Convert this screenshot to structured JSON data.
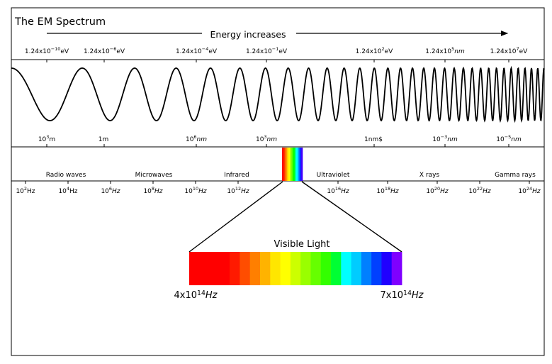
{
  "title": "The EM Spectrum",
  "energy_arrow_label": "Energy increases",
  "energy_labels": [
    {
      "base": "1.24x10",
      "exp": "−10",
      "unit": "eV",
      "unit_italic": false
    },
    {
      "base": "1.24x10",
      "exp": "−6",
      "unit": "eV",
      "unit_italic": false
    },
    {
      "base": "1.24x10",
      "exp": "−4",
      "unit": "eV",
      "unit_italic": false
    },
    {
      "base": "1.24x10",
      "exp": "−1",
      "unit": "eV",
      "unit_italic": false
    },
    {
      "base": "1.24x10",
      "exp": "2",
      "unit": "eV",
      "unit_italic": false
    },
    {
      "base": "1.24x10",
      "exp": "5",
      "unit": "nm",
      "unit_italic": true
    },
    {
      "base": "1.24x10",
      "exp": "7",
      "unit": "eV",
      "unit_italic": false
    }
  ],
  "wavelength_labels": [
    {
      "base": "10",
      "exp": "3",
      "unit": "m",
      "unit_italic": false
    },
    {
      "base": "1m",
      "exp": "",
      "unit": "",
      "unit_italic": false
    },
    {
      "base": "10",
      "exp": "6",
      "unit": "nm",
      "unit_italic": true
    },
    {
      "base": "10",
      "exp": "3",
      "unit": "nm",
      "unit_italic": true
    },
    {
      "base": "1nm$",
      "exp": "",
      "unit": "",
      "unit_italic": false
    },
    {
      "base": "10",
      "exp": "−3",
      "unit": "nm",
      "unit_italic": true
    },
    {
      "base": "10",
      "exp": "−5",
      "unit": "nm",
      "unit_italic": true
    }
  ],
  "bands": [
    "Radio waves",
    "Microwaves",
    "Infrared",
    "Ultraviolet",
    "X rays",
    "Gamma rays"
  ],
  "frequency_labels": [
    {
      "base": "10",
      "exp": "2",
      "unit": "Hz",
      "unit_italic": false
    },
    {
      "base": "10",
      "exp": "4",
      "unit": "Hz",
      "unit_italic": false
    },
    {
      "base": "10",
      "exp": "6",
      "unit": "Hz",
      "unit_italic": true
    },
    {
      "base": "10",
      "exp": "8",
      "unit": "Hz",
      "unit_italic": true
    },
    {
      "base": "10",
      "exp": "10",
      "unit": "Hz",
      "unit_italic": true
    },
    {
      "base": "10",
      "exp": "12",
      "unit": "Hz",
      "unit_italic": true
    },
    {
      "base": "10",
      "exp": "16",
      "unit": "Hz",
      "unit_italic": true
    },
    {
      "base": "10",
      "exp": "18",
      "unit": "Hz",
      "unit_italic": true
    },
    {
      "base": "10",
      "exp": "20",
      "unit": "Hz",
      "unit_italic": true
    },
    {
      "base": "10",
      "exp": "22",
      "unit": "Hz",
      "unit_italic": true
    },
    {
      "base": "10",
      "exp": "24",
      "unit": "Hz",
      "unit_italic": true
    }
  ],
  "visible": {
    "title": "Visible Light",
    "low_freq": {
      "base": "4x10",
      "exp": "14",
      "unit": "Hz"
    },
    "high_freq": {
      "base": "7x10",
      "exp": "14",
      "unit": "Hz"
    },
    "colors": [
      "#ff0000",
      "#ff0000",
      "#ff0000",
      "#ff0000",
      "#ff1a00",
      "#ff4d00",
      "#ff7f00",
      "#ffb300",
      "#ffe600",
      "#ffff00",
      "#ccff00",
      "#99ff00",
      "#66ff00",
      "#33ff00",
      "#00ff33",
      "#00ffff",
      "#00ccff",
      "#0080ff",
      "#0040ff",
      "#2000ff",
      "#7f00ff"
    ],
    "mini_colors": [
      "#ff0000",
      "#ff3300",
      "#ff8000",
      "#ffcc00",
      "#ffff00",
      "#aaff00",
      "#55ff00",
      "#00ff00",
      "#00ff99",
      "#00ffff",
      "#0099ff",
      "#0033ff",
      "#4000ff"
    ]
  }
}
